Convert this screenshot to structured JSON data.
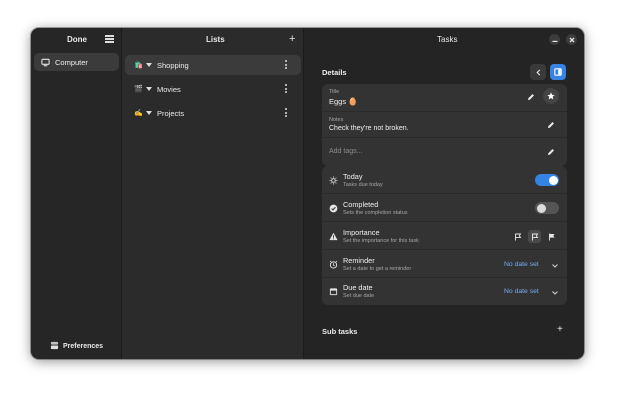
{
  "accounts_pane": {
    "header_title": "Done",
    "items": [
      {
        "label": "Computer",
        "icon": "computer-icon"
      }
    ],
    "preferences_label": "Preferences"
  },
  "lists_pane": {
    "header_title": "Lists",
    "items": [
      {
        "label": "Shopping",
        "emoji": "🛍️",
        "selected": true
      },
      {
        "label": "Movies",
        "emoji": "🎬",
        "selected": false
      },
      {
        "label": "Projects",
        "emoji": "✍️",
        "selected": false
      }
    ]
  },
  "details_pane": {
    "header_title": "Tasks",
    "section_title": "Details",
    "title_label": "Title",
    "title_value": "Eggs 🥚",
    "notes_label": "Notes",
    "notes_value": "Check they're not broken.",
    "tags_placeholder": "Add tags...",
    "today": {
      "title": "Today",
      "subtitle": "Tasks due today",
      "on": true
    },
    "completed": {
      "title": "Completed",
      "subtitle": "Sets the completion status",
      "on": false
    },
    "importance": {
      "title": "Importance",
      "subtitle": "Set the importance for this task"
    },
    "reminder": {
      "title": "Reminder",
      "subtitle": "Set a date to get a reminder",
      "value": "No date set"
    },
    "due_date": {
      "title": "Due date",
      "subtitle": "Set due date",
      "value": "No date set"
    },
    "subtasks_title": "Sub tasks"
  },
  "colors": {
    "accent": "#3584e4",
    "date_link": "#78aeed",
    "window_bg": "#242424"
  }
}
